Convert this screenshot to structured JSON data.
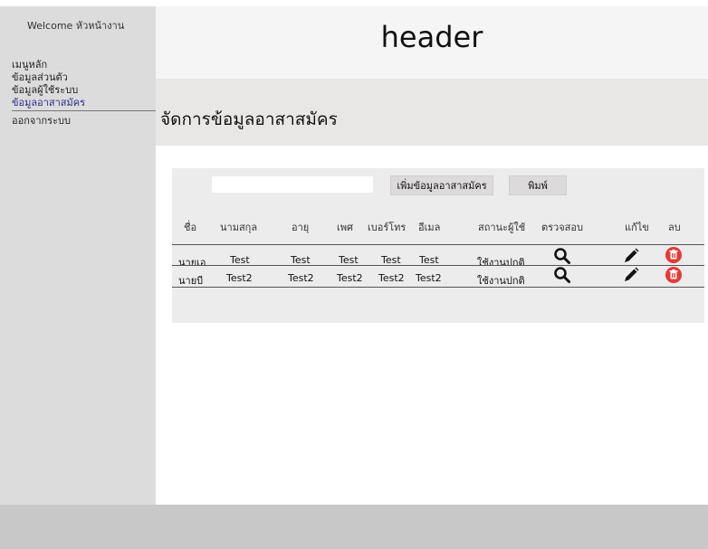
{
  "sidebar": {
    "welcome": "Welcome หัวหน้างาน",
    "menu": [
      {
        "label": "เมนูหลัก",
        "active": false
      },
      {
        "label": "ข้อมูลส่วนตัว",
        "active": false
      },
      {
        "label": "ข้อมูลผู้ใช้ระบบ",
        "active": false
      },
      {
        "label": "ข้อมูลอาสาสมัคร",
        "active": true
      },
      {
        "label": "ออกจากระบบ",
        "active": false
      }
    ]
  },
  "header": {
    "title": "header"
  },
  "page": {
    "title": "จัดการข้อมูลอาสาสมัคร"
  },
  "toolbar": {
    "search_value": "",
    "add_label": "เพิ่มข้อมูลอาสาสมัคร",
    "print_label": "พิมพ์"
  },
  "table": {
    "headers": [
      "ชื่อ",
      "นามสกุล",
      "อายุ",
      "เพศ",
      "เบอร์โทร",
      "อีเมล",
      "สถานะผู้ใช้",
      "ตรวจสอบ",
      "แก้ไข",
      "ลบ"
    ],
    "rows": [
      [
        "นายเอ",
        "Test",
        "Test",
        "Test",
        "Test",
        "Test",
        "ใช้งานปกติ"
      ],
      [
        "นายบี",
        "Test2",
        "Test2",
        "Test2",
        "Test2",
        "Test2",
        "ใช้งานปกติ"
      ]
    ],
    "icons": {
      "view": "search-icon",
      "edit": "pencil-icon",
      "delete": "trash-icon"
    }
  },
  "colors": {
    "delete": "#e53935",
    "active_menu": "#2b2b8c"
  }
}
